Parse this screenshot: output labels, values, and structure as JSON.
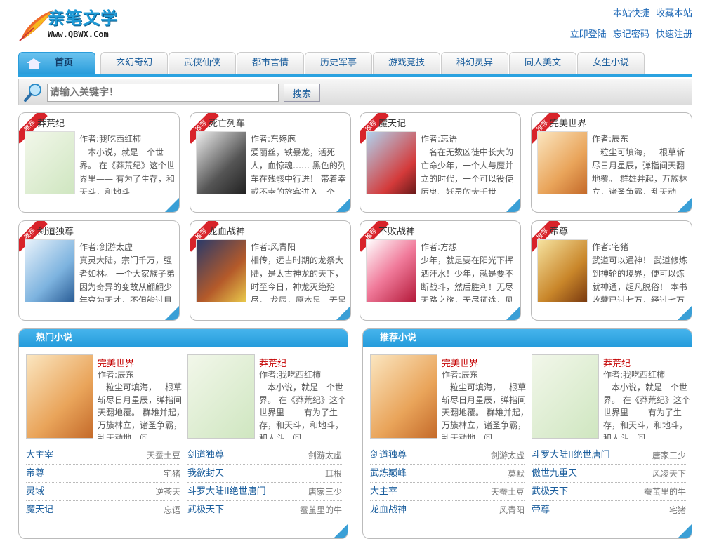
{
  "header": {
    "logo_title": "亲笔文学",
    "logo_url": "Www.QBWX.Com",
    "links_row1": [
      "本站快捷",
      "收藏本站"
    ],
    "links_row2": [
      "立即登陆",
      "忘记密码",
      "快速注册"
    ]
  },
  "nav": {
    "tabs": [
      "首页",
      "玄幻奇幻",
      "武侠仙侠",
      "都市言情",
      "历史军事",
      "游戏竞技",
      "科幻灵异",
      "同人美文",
      "女生小说"
    ]
  },
  "search": {
    "placeholder": "请输入关键字！",
    "button": "搜索"
  },
  "ribbon": "推荐",
  "cards": [
    {
      "title": "莽荒纪",
      "author": "作者:我吃西红柿",
      "desc": "一本小说，就是一个世界。 在《莽荒纪》这个世界里—— 有为了生存，和天斗，和地斗",
      "cover": "green"
    },
    {
      "title": "死亡列车",
      "author": "作者:东殇庖",
      "desc": "爱丽丝，铁暴龙，活死人，血惊魂…… 黑色的列车在残骸中行进！ 带着幸或不幸的旅客进入一个",
      "cover": "dark"
    },
    {
      "title": "魔天记",
      "author": "作者:忘语",
      "desc": "一名在无数凶徒中长大的亡命少年，一个人与魔并立的时代，一个可以役使厉鬼、妖灵的大千世",
      "cover": "red"
    },
    {
      "title": "完美世界",
      "author": "作者:辰东",
      "desc": "一粒尘可填海，一根草斩尽日月星辰，弹指间天翻地覆。 群雄并起，万族林立，诸圣争霸，乱天动",
      "cover": "warm"
    },
    {
      "title": "剑道独尊",
      "author": "作者:剑游太虚",
      "desc": "真灵大陆，宗门千万，强者如林。 一个大家族子弟因为奇异的变故从翩翩少年变为天才，不但能过目不",
      "cover": "blue"
    },
    {
      "title": "龙血战神",
      "author": "作者:风青阳",
      "desc": "相传，远古时期的龙祭大陆，是太古神龙的天下，时至今日，神龙灭绝殆尽。 龙辰，原本是一无是",
      "cover": "dragon"
    },
    {
      "title": "不败战神",
      "author": "作者:方想",
      "desc": "少年，就是要在阳光下挥洒汗水！少年，就是要不断战斗，然后胜利！无尽天路之旅，无尽征途，见",
      "cover": "pink"
    },
    {
      "title": "帝尊",
      "author": "作者:宅猪",
      "desc": "武道可以通神！ 武道修炼到神轮的境界，便可以炼就神通，超凡脱俗！ 本书收藏已过七万，经过七万",
      "cover": "gold"
    }
  ],
  "panels": [
    {
      "title": "热门小说",
      "featured": [
        {
          "title": "完美世界",
          "author": "作者:辰东",
          "desc": "一粒尘可填海，一根草斩尽日月星辰，弹指间天翻地覆。 群雄并起，万族林立，诸圣争霸，乱天动地，问",
          "cover": "warm"
        },
        {
          "title": "莽荒纪",
          "author": "作者:我吃西红柿",
          "desc": "一本小说，就是一个世界。 在《莽荒纪》这个世界里—— 有为了生存，和天斗，和地斗，和人斗，问",
          "cover": "green"
        }
      ],
      "left_list": [
        {
          "title": "大主宰",
          "author": "天蚕土豆"
        },
        {
          "title": "帝尊",
          "author": "宅猪"
        },
        {
          "title": "灵域",
          "author": "逆苍天"
        },
        {
          "title": "魔天记",
          "author": "忘语"
        }
      ],
      "right_list": [
        {
          "title": "剑道独尊",
          "author": "剑游太虚"
        },
        {
          "title": "我欲封天",
          "author": "耳根"
        },
        {
          "title": "斗罗大陆II绝世唐门",
          "author": "唐家三少"
        },
        {
          "title": "武极天下",
          "author": "蚕茧里的牛"
        }
      ]
    },
    {
      "title": "推荐小说",
      "featured": [
        {
          "title": "完美世界",
          "author": "作者:辰东",
          "desc": "一粒尘可填海，一根草斩尽日月星辰，弹指间天翻地覆。 群雄并起，万族林立，诸圣争霸，乱天动地，问",
          "cover": "warm"
        },
        {
          "title": "莽荒纪",
          "author": "作者:我吃西红柿",
          "desc": "一本小说，就是一个世界。 在《莽荒纪》这个世界里—— 有为了生存，和天斗，和地斗，和人斗，问",
          "cover": "green"
        }
      ],
      "left_list": [
        {
          "title": "剑道独尊",
          "author": "剑游太虚"
        },
        {
          "title": "武炼巅峰",
          "author": "莫默"
        },
        {
          "title": "大主宰",
          "author": "天蚕土豆"
        },
        {
          "title": "龙血战神",
          "author": "风青阳"
        }
      ],
      "right_list": [
        {
          "title": "斗罗大陆II绝世唐门",
          "author": "唐家三少"
        },
        {
          "title": "傲世九重天",
          "author": "风凌天下"
        },
        {
          "title": "武极天下",
          "author": "蚕茧里的牛"
        },
        {
          "title": "帝尊",
          "author": "宅猪"
        }
      ]
    }
  ],
  "colors": {
    "accent": "#2aa2e0",
    "link": "#1a5d9c",
    "highlight": "#c40000"
  }
}
